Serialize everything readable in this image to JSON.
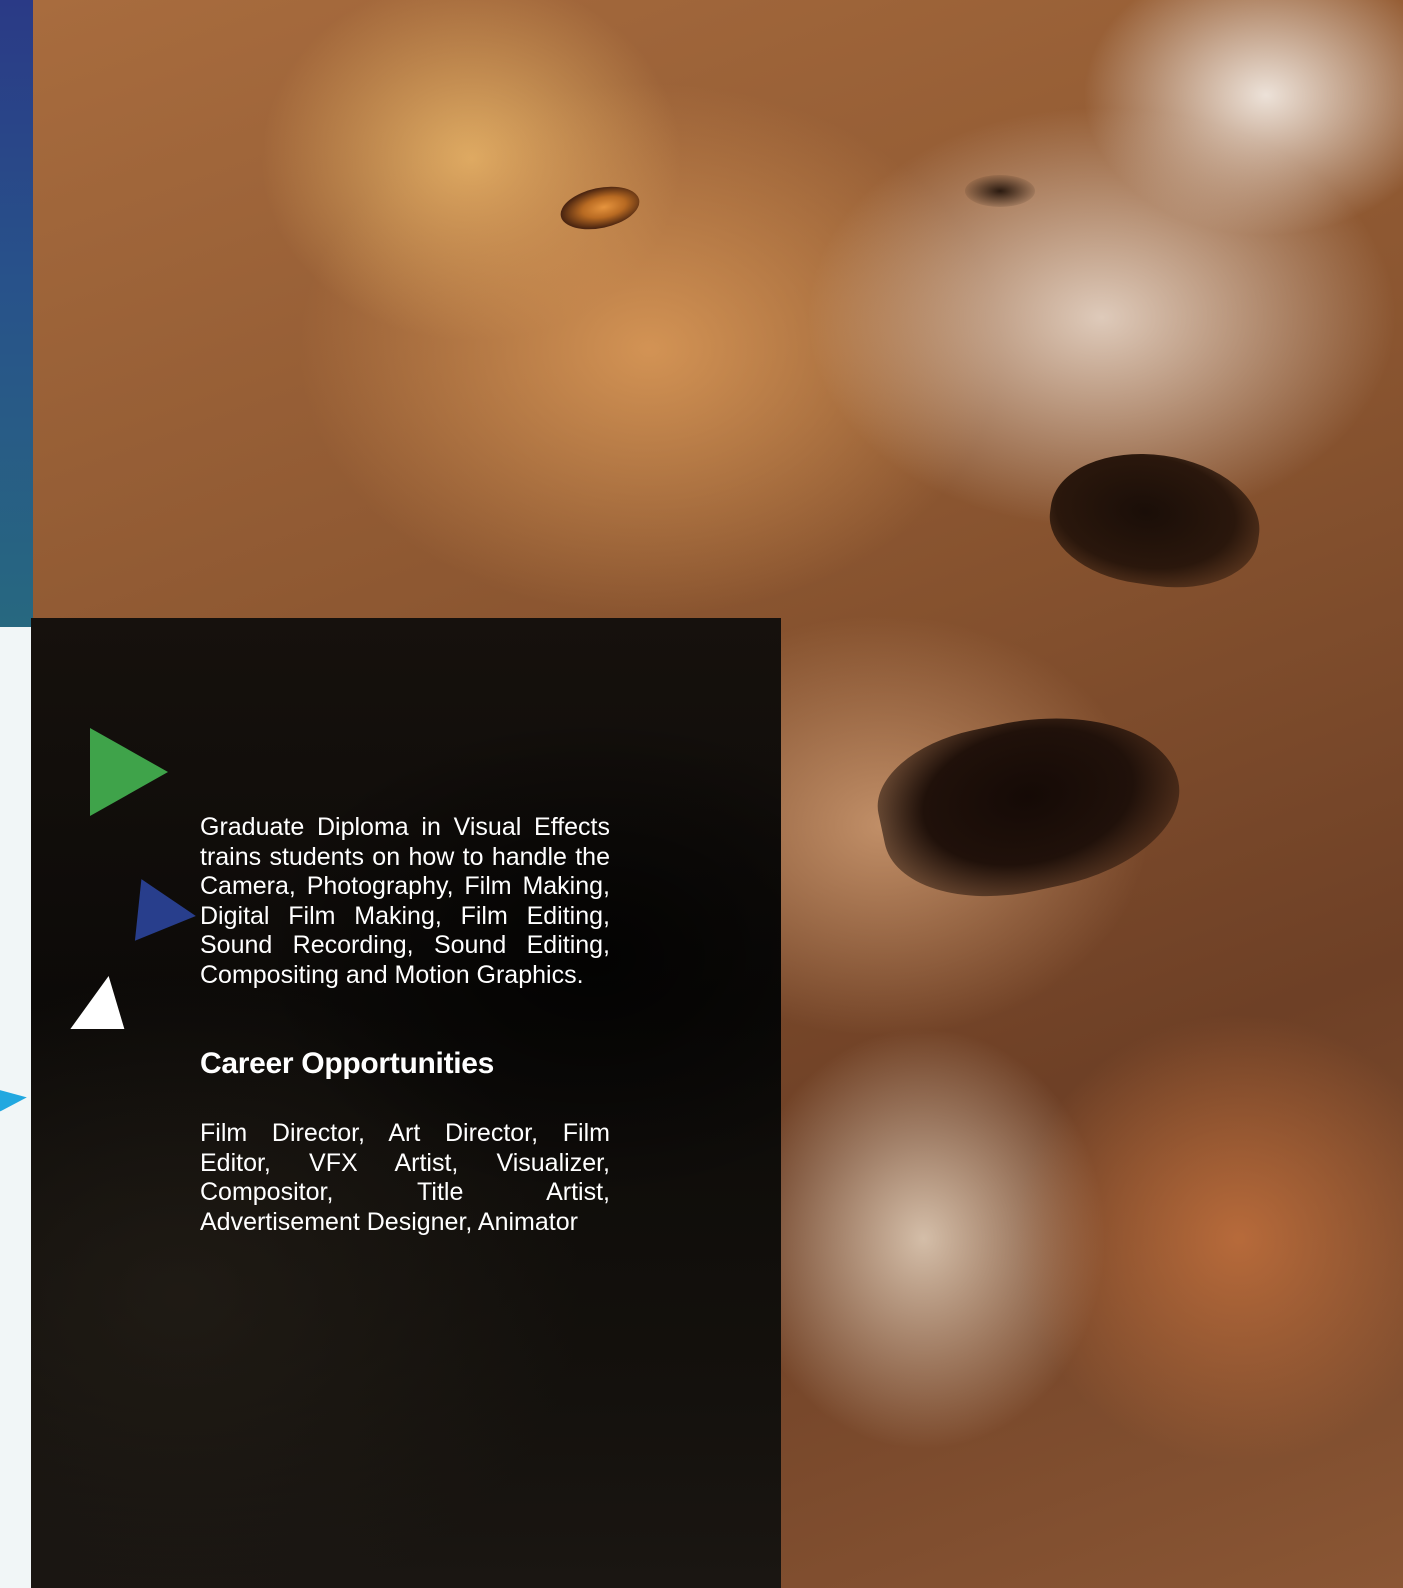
{
  "colors": {
    "strip_top": "#2a3a86",
    "strip_bottom": "#276880",
    "panel": "#0c0a08",
    "triangle_green": "#3fa34a",
    "triangle_blue": "#283e8c",
    "triangle_white": "#ffffff",
    "triangle_cyan": "#22a8e0",
    "text": "#ffffff"
  },
  "intro": "Graduate Diploma in Visual Effects trains students on how to handle the Camera, Photography, Film Making, Digital Film Making, Film Editing, Sound Recording, Sound Editing, Compositing and Motion Graphics.",
  "career_heading": "Career Opportunities",
  "career_text": "Film Director, Art Director, Film Editor, VFX Artist, Visualizer, Compositor, Title Artist, Advertisement Designer, Animator"
}
